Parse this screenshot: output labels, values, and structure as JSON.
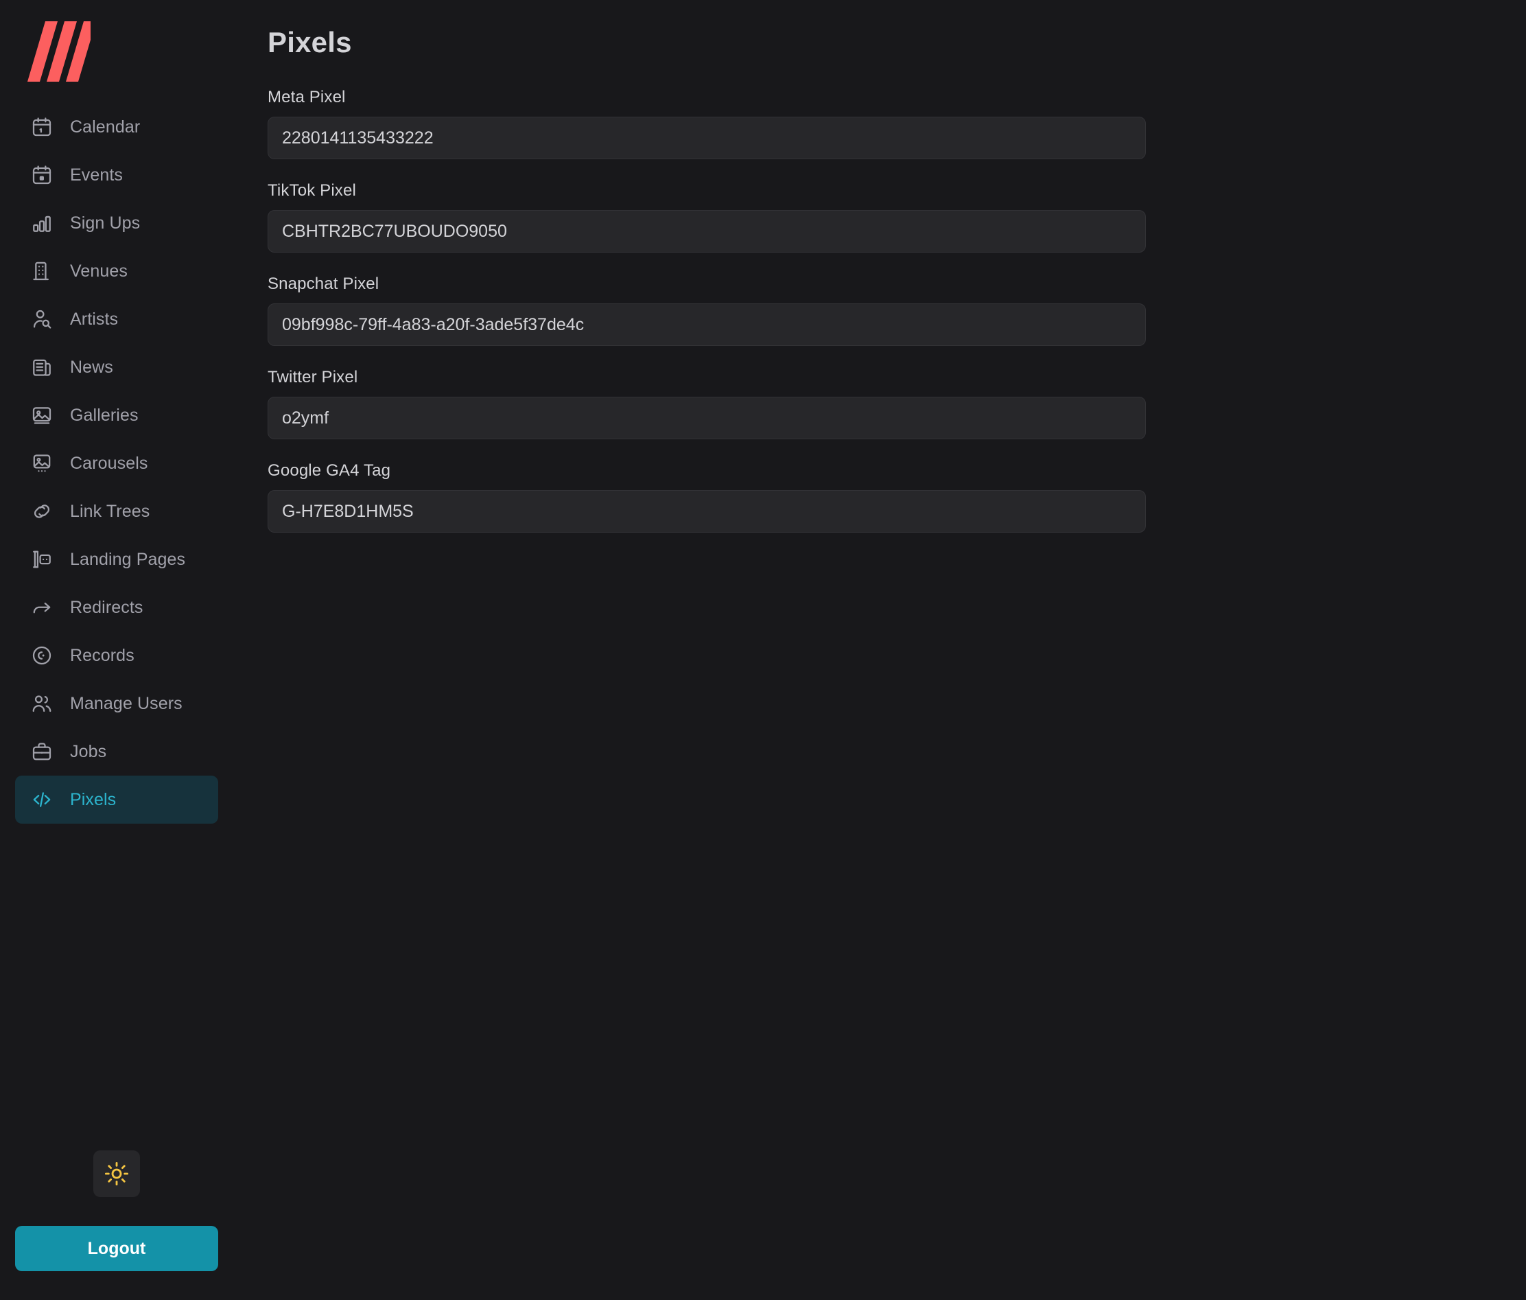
{
  "brand": {
    "logo_name": "three-slash-logo",
    "logo_color": "#fc5f5f"
  },
  "theme": {
    "background": "#18181b",
    "accent_teal": "#1492a8",
    "active_item_bg": "#16323c",
    "active_item_fg": "#2cb5ce",
    "input_bg": "#27272a",
    "text": "#d4d4d8",
    "muted_text": "#a1a1aa",
    "sun_icon_color": "#f5c542"
  },
  "sidebar": {
    "items": [
      {
        "label": "Calendar",
        "icon": "calendar-icon",
        "active": false
      },
      {
        "label": "Events",
        "icon": "calendar-event-icon",
        "active": false
      },
      {
        "label": "Sign Ups",
        "icon": "bar-chart-icon",
        "active": false
      },
      {
        "label": "Venues",
        "icon": "building-icon",
        "active": false
      },
      {
        "label": "Artists",
        "icon": "user-search-icon",
        "active": false
      },
      {
        "label": "News",
        "icon": "newspaper-icon",
        "active": false
      },
      {
        "label": "Galleries",
        "icon": "image-icon",
        "active": false
      },
      {
        "label": "Carousels",
        "icon": "carousel-icon",
        "active": false
      },
      {
        "label": "Link Trees",
        "icon": "link-icon",
        "active": false
      },
      {
        "label": "Landing Pages",
        "icon": "landing-page-icon",
        "active": false
      },
      {
        "label": "Redirects",
        "icon": "arrow-redirect-icon",
        "active": false
      },
      {
        "label": "Records",
        "icon": "disc-icon",
        "active": false
      },
      {
        "label": "Manage Users",
        "icon": "users-icon",
        "active": false
      },
      {
        "label": "Jobs",
        "icon": "briefcase-icon",
        "active": false
      },
      {
        "label": "Pixels",
        "icon": "code-icon",
        "active": true
      }
    ],
    "theme_toggle": {
      "icon": "sun-icon",
      "label": "Toggle light mode"
    },
    "logout_label": "Logout"
  },
  "main": {
    "title": "Pixels",
    "fields": [
      {
        "label": "Meta Pixel",
        "value": "2280141135433222",
        "placeholder": ""
      },
      {
        "label": "TikTok Pixel",
        "value": "CBHTR2BC77UBOUDO9050",
        "placeholder": ""
      },
      {
        "label": "Snapchat Pixel",
        "value": "09bf998c-79ff-4a83-a20f-3ade5f37de4c",
        "placeholder": ""
      },
      {
        "label": "Twitter Pixel",
        "value": "o2ymf",
        "placeholder": ""
      },
      {
        "label": "Google GA4 Tag",
        "value": "G-H7E8D1HM5S",
        "placeholder": ""
      }
    ]
  }
}
